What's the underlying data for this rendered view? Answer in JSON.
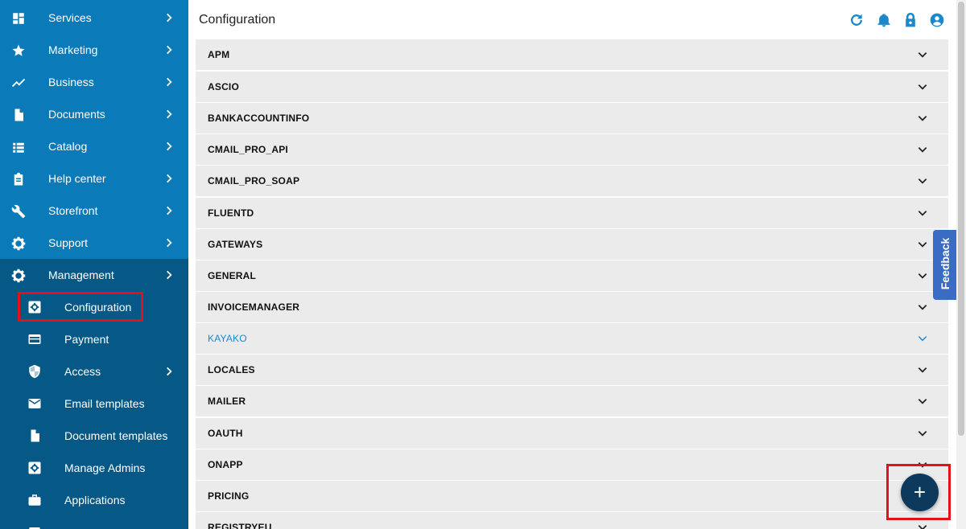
{
  "sidebar": {
    "items": [
      {
        "label": "Services",
        "icon": "dashboard-icon"
      },
      {
        "label": "Marketing",
        "icon": "star-icon"
      },
      {
        "label": "Business",
        "icon": "trending-icon"
      },
      {
        "label": "Documents",
        "icon": "document-icon"
      },
      {
        "label": "Catalog",
        "icon": "list-icon"
      },
      {
        "label": "Help center",
        "icon": "clipboard-icon"
      },
      {
        "label": "Storefront",
        "icon": "wrench-icon"
      },
      {
        "label": "Support",
        "icon": "gear-icon"
      },
      {
        "label": "Management",
        "icon": "gear-icon"
      }
    ],
    "management_items": [
      {
        "label": "Configuration",
        "icon": "settings-box-icon"
      },
      {
        "label": "Payment",
        "icon": "credit-card-icon"
      },
      {
        "label": "Access",
        "icon": "shield-icon"
      },
      {
        "label": "Email templates",
        "icon": "envelope-icon"
      },
      {
        "label": "Document templates",
        "icon": "document-icon"
      },
      {
        "label": "Manage Admins",
        "icon": "settings-box-icon"
      },
      {
        "label": "Applications",
        "icon": "briefcase-icon"
      }
    ]
  },
  "header": {
    "title": "Configuration",
    "icons": [
      "refresh-icon",
      "bell-icon",
      "lock-icon",
      "account-icon"
    ]
  },
  "config_sections": [
    {
      "label": "APM"
    },
    {
      "label": "ASCIO"
    },
    {
      "label": "BANKACCOUNTINFO"
    },
    {
      "label": "CMAIL_PRO_API"
    },
    {
      "label": "CMAIL_PRO_SOAP"
    },
    {
      "label": "FLUENTD"
    },
    {
      "label": "GATEWAYS"
    },
    {
      "label": "GENERAL"
    },
    {
      "label": "INVOICEMANAGER"
    },
    {
      "label": "KAYAKO",
      "active": true
    },
    {
      "label": "LOCALES"
    },
    {
      "label": "MAILER"
    },
    {
      "label": "OAUTH"
    },
    {
      "label": "ONAPP"
    },
    {
      "label": "PRICING"
    },
    {
      "label": "REGISTRYEU"
    }
  ],
  "feedback": {
    "label": "Feedback"
  },
  "fab": {
    "label": "+"
  },
  "colors": {
    "sidebar": "#0a7bb8",
    "sidebar_sub": "#065986",
    "accent": "#1d88c9",
    "fab": "#0d3a5c",
    "highlight": "#e3121a",
    "feedback": "#3b6cc4"
  }
}
